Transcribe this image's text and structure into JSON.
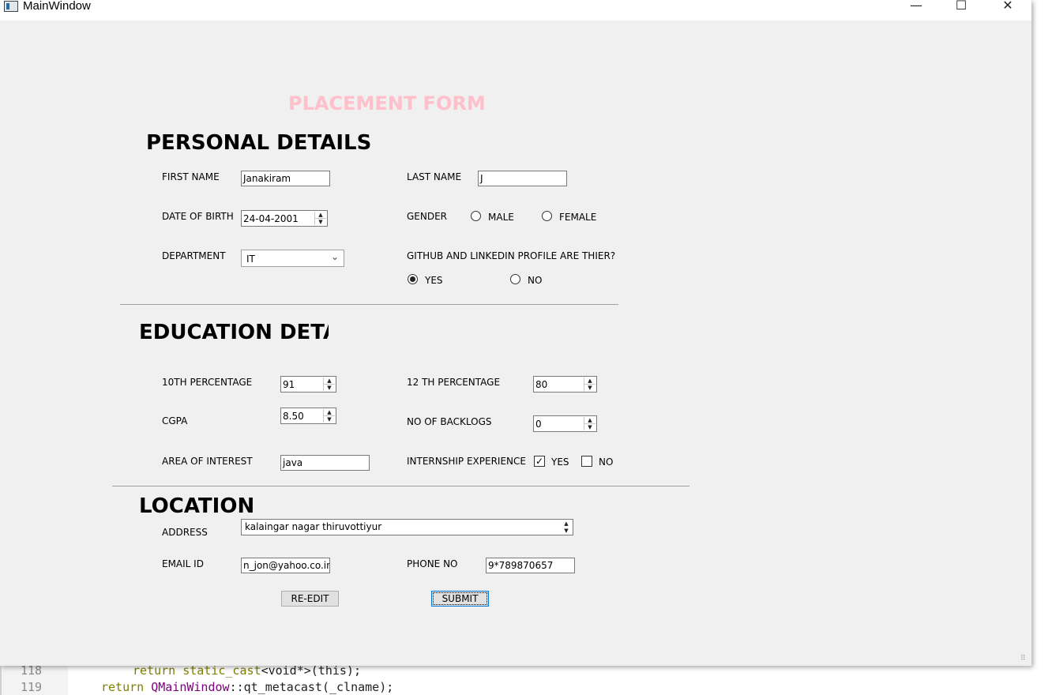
{
  "window": {
    "title": "MainWindow",
    "minimize": "—",
    "maximize": "☐",
    "close": "✕"
  },
  "form_title": "PLACEMENT FORM",
  "personal": {
    "heading": "PERSONAL DETAILS",
    "first_name_label": "FIRST NAME",
    "first_name_value": "Janakiram",
    "last_name_label": "LAST NAME",
    "last_name_value": "J",
    "dob_label": "DATE OF BIRTH",
    "dob_value": "24-04-2001",
    "gender_label": "GENDER",
    "gender_male": "MALE",
    "gender_female": "FEMALE",
    "gender_selected": "",
    "department_label": "DEPARTMENT",
    "department_value": "IT",
    "profile_question": "GITHUB AND LINKEDIN PROFILE ARE THIER?",
    "profile_yes": "YES",
    "profile_no": "NO",
    "profile_selected": "YES"
  },
  "education": {
    "heading": "EDUCATION DETA:",
    "tenth_label": "10TH PERCENTAGE",
    "tenth_value": "91",
    "twelfth_label": "12 TH PERCENTAGE",
    "twelfth_value": "80",
    "cgpa_label": "CGPA",
    "cgpa_value": "8.50",
    "backlogs_label": "NO OF BACKLOGS",
    "backlogs_value": "0",
    "interest_label": "AREA OF INTEREST",
    "interest_value": "java",
    "internship_label": "INTERNSHIP EXPERIENCE",
    "internship_yes": "YES",
    "internship_no": "NO",
    "internship_yes_checked": true,
    "internship_no_checked": false
  },
  "location": {
    "heading": "LOCATION",
    "address_label": "ADDRESS",
    "address_value": "kalaingar nagar thiruvottiyur",
    "email_label": "EMAIL ID",
    "email_value": "n_jon@yahoo.co.in",
    "phone_label": "PHONE NO",
    "phone_value": "9*789870657"
  },
  "buttons": {
    "reedit": "RE-EDIT",
    "submit": "SUBMIT"
  },
  "editor": {
    "lines": [
      {
        "number": "118",
        "pre": "    ",
        "kw1": "return ",
        "kw2": "static_cast",
        "rest": "<void*>(this);"
      },
      {
        "number": "119",
        "pre": "",
        "kw1": "return ",
        "kw2": "QMainWindow",
        "rest": "::qt_metacast(_clname);"
      }
    ]
  },
  "colors": {
    "form_title": "#ffc0cb",
    "window_bg": "#f0f0f0"
  },
  "icons": {
    "spin_up": "▲",
    "spin_down": "▼",
    "combo_arrow": "⌄",
    "check": "✓",
    "grip": "⠿"
  }
}
